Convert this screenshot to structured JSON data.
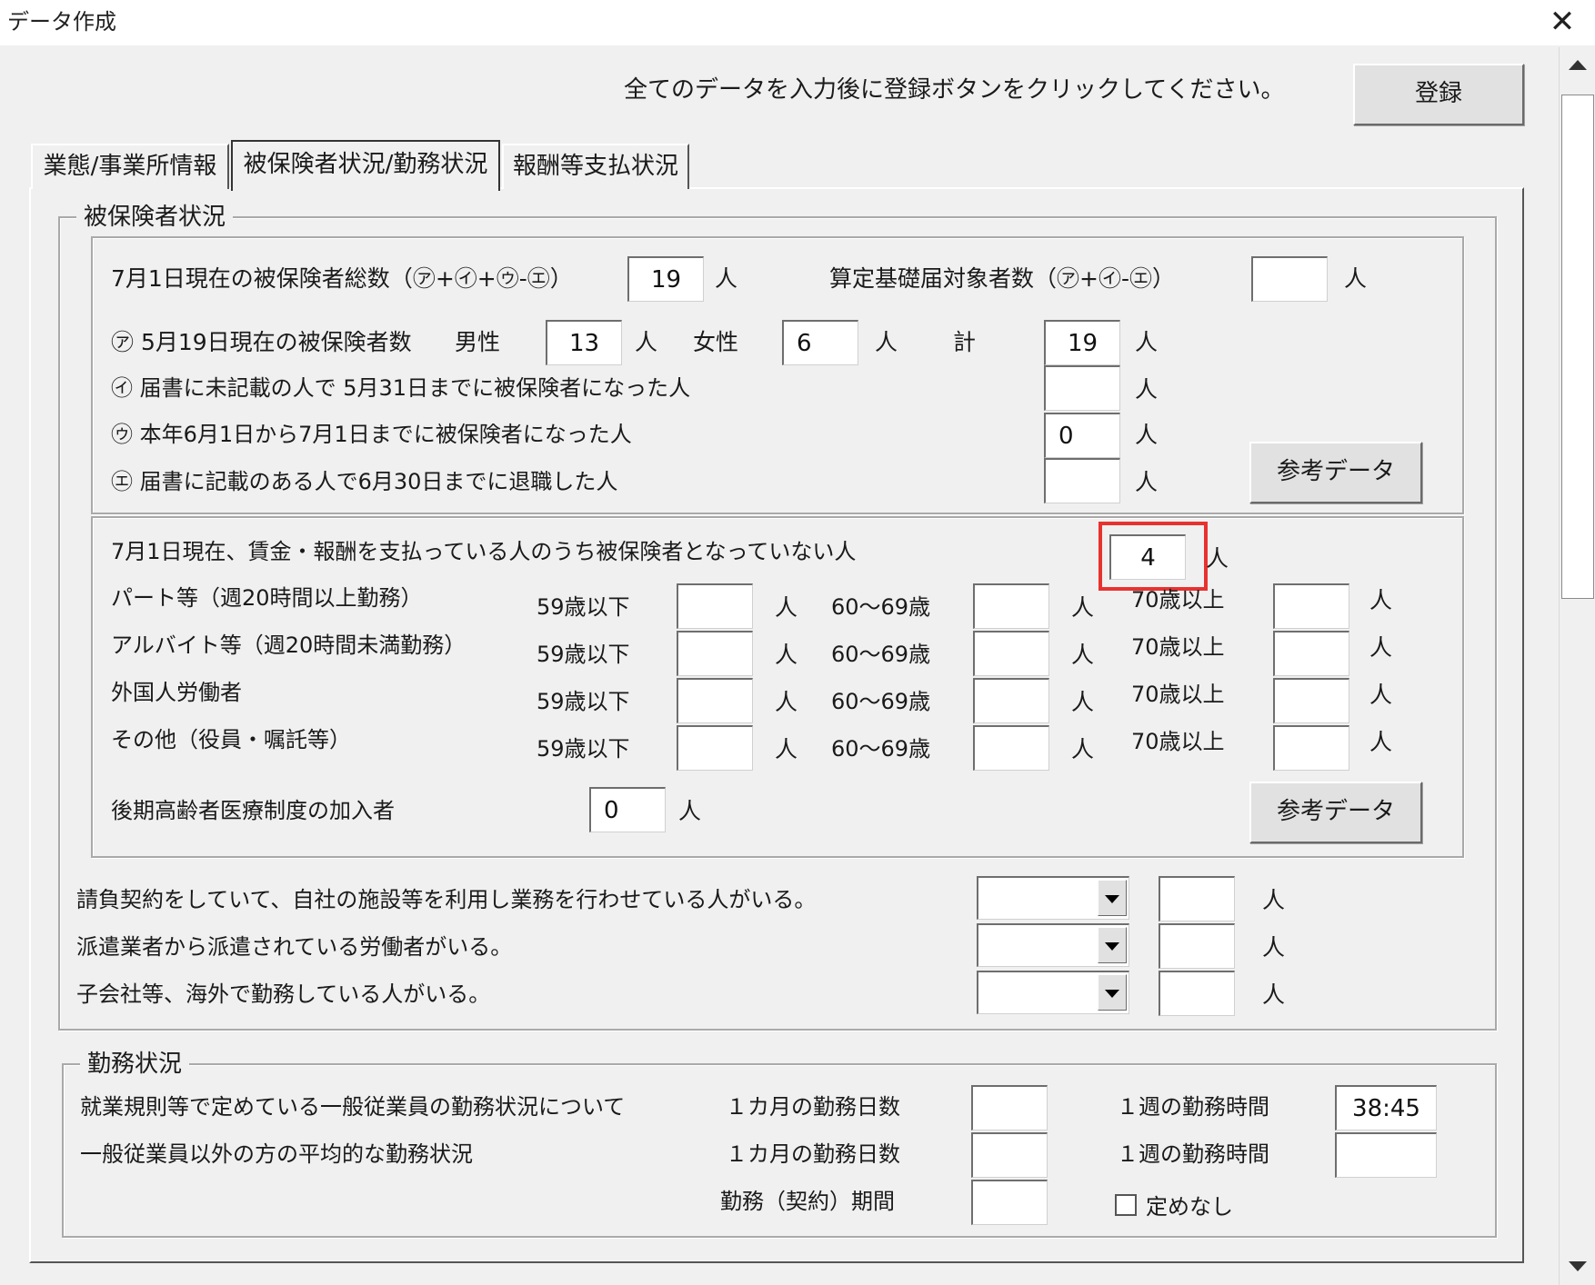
{
  "window": {
    "title": "データ作成",
    "close_label": "✕"
  },
  "header": {
    "instruction": "全てのデータを入力後に登録ボタンをクリックしてください。",
    "register_label": "登録"
  },
  "tabs": [
    {
      "label": "業態/事業所情報"
    },
    {
      "label": "被保険者状況/勤務状況"
    },
    {
      "label": "報酬等支払状況"
    }
  ],
  "unit": "人",
  "insured": {
    "legend": "被保険者状況",
    "total_label": "7月1日現在の被保険者総数（㋐+㋑+㋒-㋓）",
    "total_value": "19",
    "santei_label": "算定基礎届対象者数（㋐+㋑-㋓）",
    "santei_value": "",
    "a_label": "㋐ 5月19日現在の被保険者数",
    "male_label": "男性",
    "male_value": "13",
    "female_label": "女性",
    "female_value": "6",
    "sum_label": "計",
    "sum_value": "19",
    "i_label": "㋑ 届書に未記載の人で 5月31日までに被保険者になった人",
    "i_value": "",
    "u_label": "㋒ 本年6月1日から7月1日までに被保険者になった人",
    "u_value": "0",
    "e_label": "㋓ 届書に記載のある人で6月30日までに退職した人",
    "e_value": "",
    "reference_label": "参考データ"
  },
  "uninsured": {
    "title": "7月1日現在、賃金・報酬を支払っている人のうち被保険者となっていない人",
    "total_value": "4",
    "age_labels": [
      "59歳以下",
      "60～69歳",
      "70歳以上"
    ],
    "rows": [
      {
        "label": "パート等（週20時間以上勤務）",
        "values": [
          "",
          "",
          ""
        ]
      },
      {
        "label": "アルバイト等（週20時間未満勤務）",
        "values": [
          "",
          "",
          ""
        ]
      },
      {
        "label": "外国人労働者",
        "values": [
          "",
          "",
          ""
        ]
      },
      {
        "label": "その他（役員・嘱託等）",
        "values": [
          "",
          "",
          ""
        ]
      }
    ],
    "elderly_label": "後期高齢者医療制度の加入者",
    "elderly_value": "0",
    "reference_label": "参考データ"
  },
  "contracts": [
    {
      "label": "請負契約をしていて、自社の施設等を利用し業務を行わせている人がいる。",
      "select": "",
      "value": ""
    },
    {
      "label": "派遣業者から派遣されている労働者がいる。",
      "select": "",
      "value": ""
    },
    {
      "label": "子会社等、海外で勤務している人がいる。",
      "select": "",
      "value": ""
    }
  ],
  "work": {
    "legend": "勤務状況",
    "regular_label": "就業規則等で定めている一般従業員の勤務状況について",
    "other_label": "一般従業員以外の方の平均的な勤務状況",
    "days_label": "１カ月の勤務日数",
    "hours_label": "１週の勤務時間",
    "regular_days": "",
    "regular_hours": "38:45",
    "other_days": "",
    "other_hours": "",
    "period_label": "勤務（契約）期間",
    "period_value": "",
    "undefined_label": "定めなし"
  }
}
